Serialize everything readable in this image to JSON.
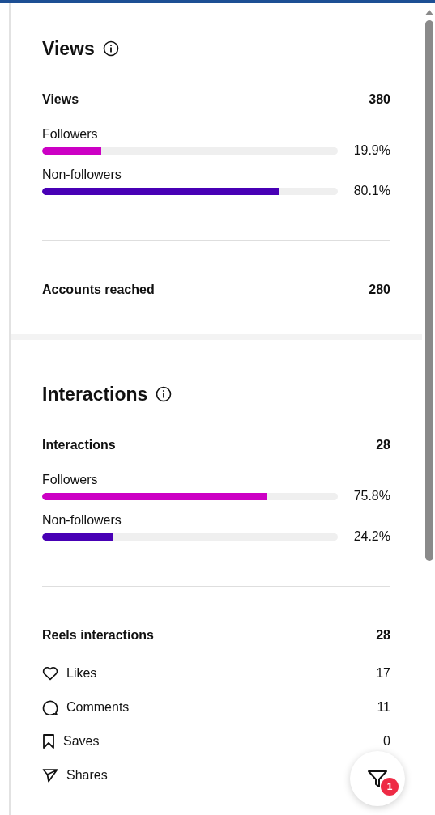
{
  "sections": [
    {
      "title": "Views",
      "total": {
        "label": "Views",
        "value": "380"
      },
      "bars": [
        {
          "label": "Followers",
          "level": 0.199,
          "reading": "19.9%",
          "color": "#cc00c4"
        },
        {
          "label": "Non-followers",
          "level": 0.801,
          "reading": "80.1%",
          "color": "#4800b5"
        }
      ],
      "summary": {
        "label": "Accounts reached",
        "value": "280"
      }
    },
    {
      "title": "Interactions",
      "total": {
        "label": "Interactions",
        "value": "28"
      },
      "bars": [
        {
          "label": "Followers",
          "level": 0.758,
          "reading": "75.8%",
          "color": "#cc00c4"
        },
        {
          "label": "Non-followers",
          "level": 0.242,
          "reading": "24.2%",
          "color": "#4800b5"
        }
      ],
      "summary": {
        "label": "Reels interactions",
        "value": "28"
      },
      "breakdown": [
        {
          "kind": "likes",
          "label": "Likes",
          "value": "17"
        },
        {
          "kind": "comments",
          "label": "Comments",
          "value": "11"
        },
        {
          "kind": "saves",
          "label": "Saves",
          "value": "0"
        },
        {
          "kind": "shares",
          "label": "Shares"
        }
      ]
    }
  ],
  "filter_button": {
    "badge": "1"
  }
}
